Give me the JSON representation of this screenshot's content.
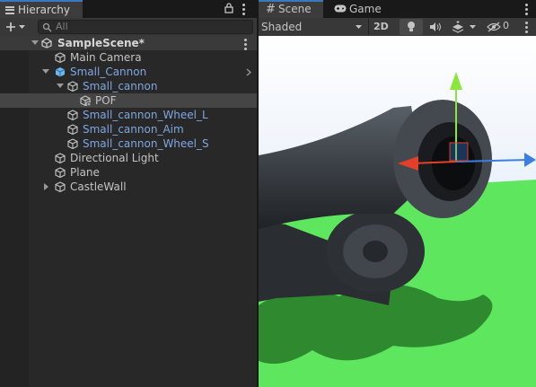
{
  "hierarchy": {
    "title": "Hierarchy",
    "search_placeholder": "All",
    "scene_name": "SampleScene*",
    "items": [
      {
        "label": "Main Camera"
      },
      {
        "label": "Small_Cannon"
      },
      {
        "label": "Small_cannon"
      },
      {
        "label": "POF"
      },
      {
        "label": "Small_cannon_Wheel_L"
      },
      {
        "label": "Small_cannon_Aim"
      },
      {
        "label": "Small_cannon_Wheel_S"
      },
      {
        "label": "Directional Light"
      },
      {
        "label": "Plane"
      },
      {
        "label": "CastleWall"
      }
    ]
  },
  "scene_view": {
    "tabs": [
      {
        "label": "Scene"
      },
      {
        "label": "Game"
      }
    ],
    "shading_mode": "Shaded",
    "mode_2d": "2D",
    "hidden_count": "0"
  },
  "colors": {
    "accent": "#3a79bb",
    "prefab_text": "#7fa7e2",
    "ground": "#5ee65e",
    "sky": "#cfe0f5"
  },
  "icons": [
    "menu-icon",
    "lock-icon",
    "more-icon",
    "add-icon",
    "search-icon",
    "unity-scene-icon",
    "gameobject-icon",
    "prefab-icon",
    "hash-icon",
    "gamepad-icon",
    "lightbulb-icon",
    "audio-icon",
    "effects-icon",
    "visibility-icon"
  ]
}
